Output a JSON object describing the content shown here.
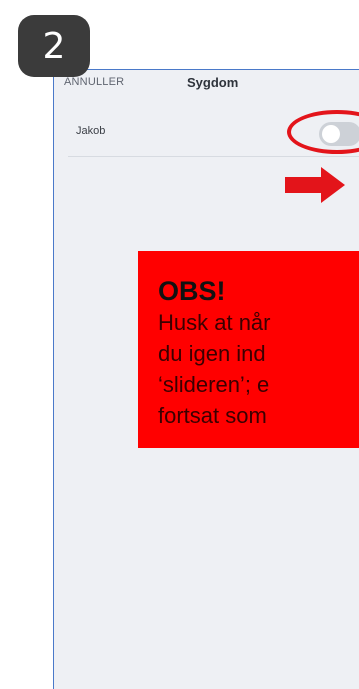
{
  "step_badge": "2",
  "header": {
    "cancel_label": "ANNULLER",
    "title": "Sygdom"
  },
  "row": {
    "label": "Jakob",
    "toggle_on": false
  },
  "notice": {
    "title": "OBS!",
    "lines": [
      "Husk at når",
      "du igen ind",
      " ‘slideren’; e",
      "fortsat som"
    ]
  },
  "colors": {
    "annotation_red": "#e3141a",
    "notice_bg": "#ff0000",
    "frame_border": "#4a79c9"
  },
  "icons": {
    "arrow": "arrow-right-icon"
  }
}
